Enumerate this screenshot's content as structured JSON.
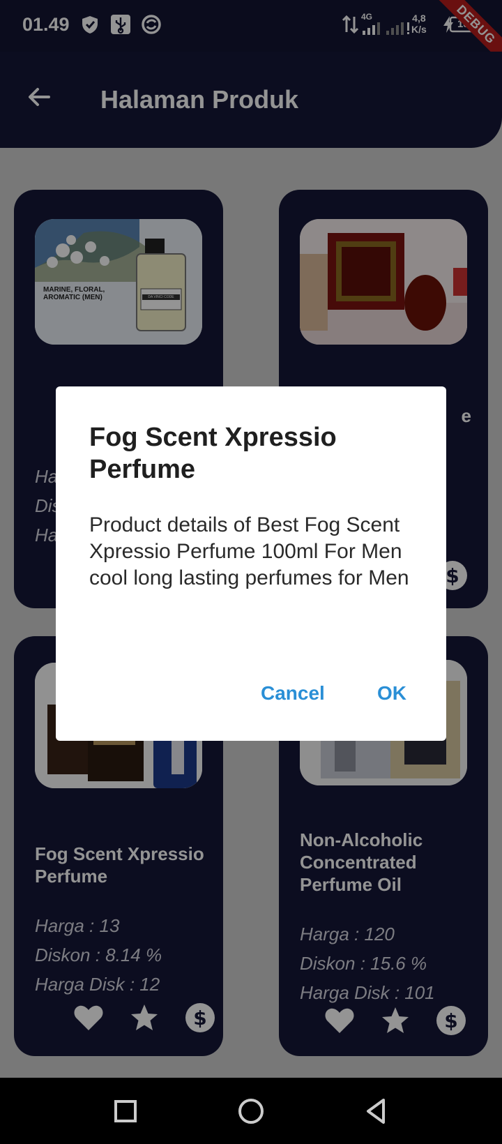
{
  "status_bar": {
    "time": "01.49",
    "network_type": "4G",
    "speed_value": "4,8",
    "speed_unit": "K/s",
    "battery": "18",
    "debug_banner": "DEBUG",
    "icons": [
      "shield-icon",
      "usb-icon",
      "sync-icon",
      "data-arrows-icon",
      "signal-icon",
      "charging-icon",
      "battery-icon"
    ]
  },
  "app_bar": {
    "title": "Halaman Produk",
    "back_icon": "arrow-back-icon"
  },
  "products": [
    {
      "name": "",
      "image_text": "MARINE, FLORAL, AROMATIC (MEN)",
      "bottle_label": "DA VINCI CODE",
      "price_label": "Ha",
      "discount_label": "Dis",
      "disc_price_label": "Ha"
    },
    {
      "name": "e",
      "price_label": "",
      "discount_label": "",
      "disc_price_label": ""
    },
    {
      "name": "Fog Scent Xpressio Perfume",
      "price_label": "Harga : 13",
      "discount_label": "Diskon : 8.14 %",
      "disc_price_label": "Harga Disk : 12"
    },
    {
      "name": "Non-Alcoholic Concentrated Perfume Oil",
      "price_label": "Harga : 120",
      "discount_label": "Diskon : 15.6 %",
      "disc_price_label": "Harga Disk : 101"
    }
  ],
  "card_actions": [
    "heart-icon",
    "star-icon",
    "dollar-icon"
  ],
  "dialog": {
    "title": "Fog Scent Xpressio Perfume",
    "body": "Product details of Best Fog Scent Xpressio Perfume 100ml For Men cool long lasting perfumes for Men",
    "cancel_label": "Cancel",
    "ok_label": "OK"
  },
  "colors": {
    "primary_dark": "#161838",
    "accent_blue": "#2a8fd6",
    "debug_red": "#b71c1c"
  },
  "nav_bar": {
    "buttons": [
      "recents-square-icon",
      "home-circle-icon",
      "back-triangle-icon"
    ]
  }
}
